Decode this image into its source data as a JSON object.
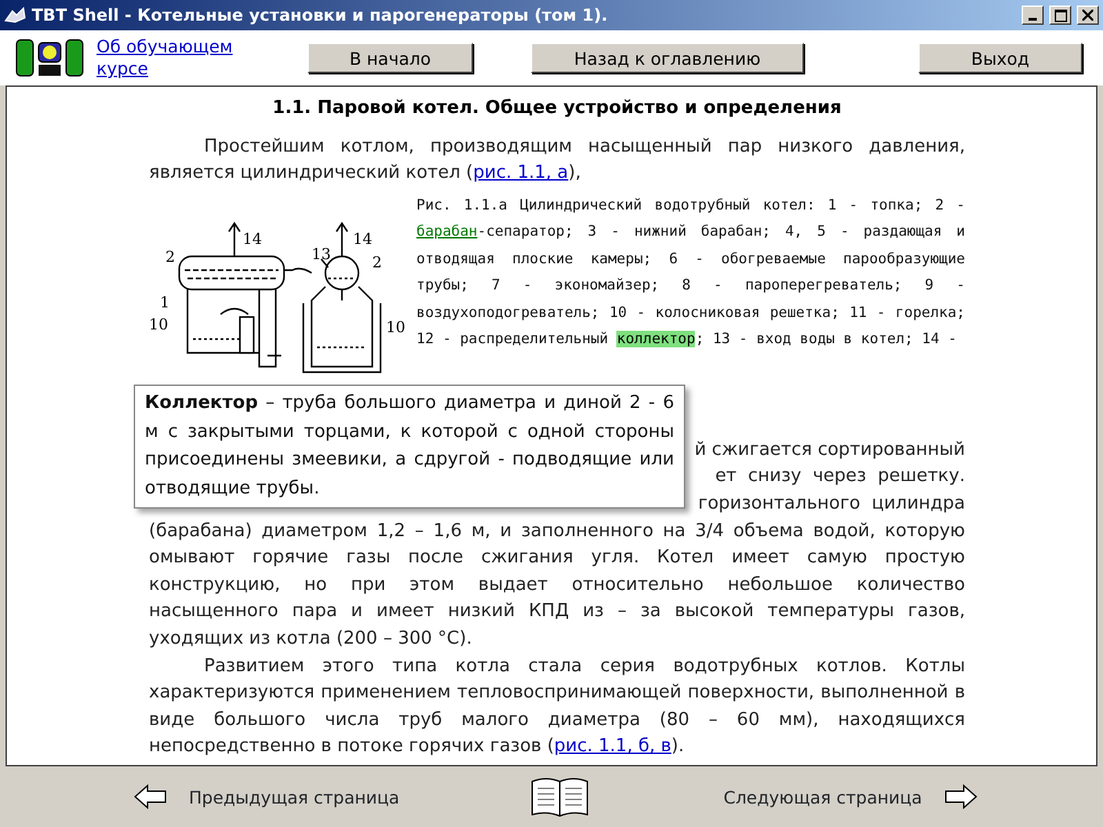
{
  "window": {
    "title": "TBT Shell - Котельные установки и парогенераторы (том 1)."
  },
  "toolbar": {
    "about_link": "Об обучающем курсе",
    "buttons": [
      "В начало",
      "Назад к оглавлению",
      "Выход"
    ]
  },
  "heading": "1.1. Паровой котел. Общее устройство и определения",
  "paragraph_1": [
    {
      "kind": "plain",
      "text": "Простейшим котлом, производящим насыщенный пар низкого давления, является цилиндрический котел ("
    },
    {
      "kind": "link",
      "text": "рис. 1.1, а"
    },
    {
      "kind": "plain",
      "text": "),"
    }
  ],
  "figure": {
    "labels": [
      "14",
      "2",
      "1",
      "10",
      "14",
      "13",
      "2",
      "10"
    ],
    "caption": [
      {
        "kind": "plain",
        "text": "Рис. 1.1.а Цилиндрический водотрубный котел: 1 - топка; 2 - "
      },
      {
        "kind": "term",
        "text": "барабан"
      },
      {
        "kind": "plain",
        "text": "-сепаратор; 3 - нижний барабан; 4, 5 - раздающая и отводящая плоские камеры; 6 - обогреваемые парообразующие трубы; 7 - экономайзер; 8 - пароперегреватель; 9 - воздухоподогреватель; 10 - колосниковая решетка; 11 - горелка; 12 - распределительный "
      },
      {
        "kind": "highlight",
        "text": "коллектор"
      },
      {
        "kind": "plain",
        "text": "; 13 - вход воды в котел; 14 -"
      }
    ]
  },
  "tooltip": {
    "text": "**Коллектор** – труба большого диаметра и диной 2 - 6 м с закрытыми торцами, к которой с одной стороны присоединены змеевики, а сдругой - подводящие или отводящие трубы."
  },
  "paragraph_2": {
    "covered_fragments": [
      "й сжигается сортированный",
      "ет  снизу  через  решетку.",
      "горизонтального  цилиндра"
    ],
    "text": "(барабана) диаметром 1,2 – 1,6 м, и заполненного на 3/4 объема водой, которую омывают горячие газы после сжигания угля. Котел имеет самую простую конструкцию, но при этом выдает относительно небольшое количество насыщенного пара и имеет низкий КПД из – за высокой температуры газов, уходящих из котла (200 – 300 °С)."
  },
  "paragraph_3": [
    {
      "kind": "plain",
      "text": "Развитием этого типа котла стала серия водотрубных котлов. Котлы характеризуются применением тепловоспринимающей поверхности, выполненной в виде большого числа труб малого диаметра (80 – 60 мм), находящихся непосредственно в потоке горячих газов ("
    },
    {
      "kind": "link",
      "text": "рис. 1.1, б, в"
    },
    {
      "kind": "plain",
      "text": ")."
    }
  ],
  "bottom_nav": {
    "previous": "Предыдущая страница",
    "next": "Следующая страница"
  }
}
